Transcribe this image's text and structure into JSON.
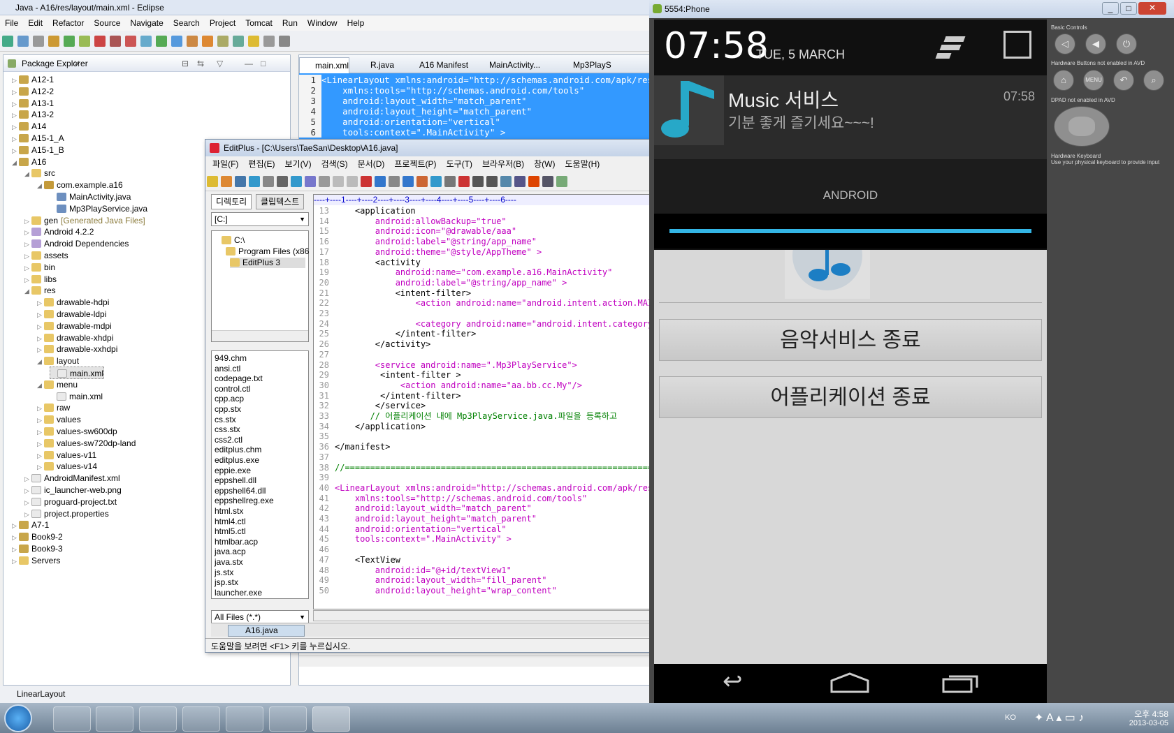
{
  "eclipse": {
    "title": "Java - A16/res/layout/main.xml - Eclipse",
    "menu": [
      "File",
      "Edit",
      "Refactor",
      "Source",
      "Navigate",
      "Search",
      "Project",
      "Tomcat",
      "Run",
      "Window",
      "Help"
    ],
    "package_explorer": {
      "title": "Package Explorer",
      "tree": [
        {
          "label": "A12-1",
          "kind": "project"
        },
        {
          "label": "A12-2",
          "kind": "project"
        },
        {
          "label": "A13-1",
          "kind": "project"
        },
        {
          "label": "A13-2",
          "kind": "project"
        },
        {
          "label": "A14",
          "kind": "project"
        },
        {
          "label": "A15-1_A",
          "kind": "project"
        },
        {
          "label": "A15-1_B",
          "kind": "project"
        },
        {
          "label": "A16",
          "kind": "project"
        },
        {
          "label": "src",
          "kind": "folder"
        },
        {
          "label": "com.example.a16",
          "kind": "package"
        },
        {
          "label": "MainActivity.java",
          "kind": "java"
        },
        {
          "label": "Mp3PlayService.java",
          "kind": "java"
        },
        {
          "label": "gen",
          "kind": "folder",
          "suffix": "[Generated Java Files]"
        },
        {
          "label": "Android 4.2.2",
          "kind": "lib"
        },
        {
          "label": "Android Dependencies",
          "kind": "lib"
        },
        {
          "label": "assets",
          "kind": "folder"
        },
        {
          "label": "bin",
          "kind": "folder"
        },
        {
          "label": "libs",
          "kind": "folder"
        },
        {
          "label": "res",
          "kind": "folder"
        },
        {
          "label": "drawable-hdpi",
          "kind": "folder"
        },
        {
          "label": "drawable-ldpi",
          "kind": "folder"
        },
        {
          "label": "drawable-mdpi",
          "kind": "folder"
        },
        {
          "label": "drawable-xhdpi",
          "kind": "folder"
        },
        {
          "label": "drawable-xxhdpi",
          "kind": "folder"
        },
        {
          "label": "layout",
          "kind": "folder"
        },
        {
          "label": "main.xml",
          "kind": "xml",
          "selected": true
        },
        {
          "label": "menu",
          "kind": "folder"
        },
        {
          "label": "main.xml",
          "kind": "xml"
        },
        {
          "label": "raw",
          "kind": "folder"
        },
        {
          "label": "values",
          "kind": "folder"
        },
        {
          "label": "values-sw600dp",
          "kind": "folder"
        },
        {
          "label": "values-sw720dp-land",
          "kind": "folder"
        },
        {
          "label": "values-v11",
          "kind": "folder"
        },
        {
          "label": "values-v14",
          "kind": "folder"
        },
        {
          "label": "AndroidManifest.xml",
          "kind": "xml"
        },
        {
          "label": "ic_launcher-web.png",
          "kind": "xml"
        },
        {
          "label": "proguard-project.txt",
          "kind": "xml"
        },
        {
          "label": "project.properties",
          "kind": "xml"
        },
        {
          "label": "A7-1",
          "kind": "project"
        },
        {
          "label": "Book9-2",
          "kind": "project"
        },
        {
          "label": "Book9-3",
          "kind": "project"
        },
        {
          "label": "Servers",
          "kind": "folder"
        }
      ]
    },
    "editor_tabs": [
      "main.xml",
      "R.java",
      "A16 Manifest",
      "MainActivity...",
      "Mp3PlayS"
    ],
    "editor_lines": [
      "<LinearLayout xmlns:android=\"http://schemas.android.com/apk/res/a",
      "    xmlns:tools=\"http://schemas.android.com/tools\"",
      "    android:layout_width=\"match_parent\"",
      "    android:layout_height=\"match_parent\"",
      "    android:orientation=\"vertical\"",
      "    tools:context=\".MainActivity\" >"
    ],
    "status": "LinearLayout"
  },
  "editplus": {
    "title": "EditPlus - [C:\\Users\\TaeSan\\Desktop\\A16.java]",
    "menu": [
      "파일(F)",
      "편집(E)",
      "보기(V)",
      "검색(S)",
      "문서(D)",
      "프로젝트(P)",
      "도구(T)",
      "브라우저(B)",
      "창(W)",
      "도움말(H)"
    ],
    "side_tabs": [
      "디렉토리",
      "클립텍스트"
    ],
    "drive": "[C:]",
    "dirs": [
      "C:\\",
      "Program Files (x86",
      "EditPlus 3"
    ],
    "files": [
      "949.chm",
      "ansi.ctl",
      "codepage.txt",
      "control.ctl",
      "cpp.acp",
      "cpp.stx",
      "cs.stx",
      "css.stx",
      "css2.ctl",
      "editplus.chm",
      "editplus.exe",
      "eppie.exe",
      "eppshell.dll",
      "eppshell64.dll",
      "eppshellreg.exe",
      "html.stx",
      "html4.ctl",
      "html5.ctl",
      "htmlbar.acp",
      "java.acp",
      "java.stx",
      "js.stx",
      "jsp.stx",
      "launcher.exe"
    ],
    "filter": "All Files (*.*)",
    "open_tab": "A16.java",
    "ruler": "----+----1----+----2----+----3----+----4----+----5----+----6----",
    "code": [
      {
        "n": "13",
        "t": "    <application"
      },
      {
        "n": "14",
        "t": "        android:allowBackup=\"true\""
      },
      {
        "n": "15",
        "t": "        android:icon=\"@drawable/aaa\""
      },
      {
        "n": "16",
        "t": "        android:label=\"@string/app_name\""
      },
      {
        "n": "17",
        "t": "        android:theme=\"@style/AppTheme\" >"
      },
      {
        "n": "18",
        "t": "        <activity"
      },
      {
        "n": "19",
        "t": "            android:name=\"com.example.a16.MainActivity\""
      },
      {
        "n": "20",
        "t": "            android:label=\"@string/app_name\" >"
      },
      {
        "n": "21",
        "t": "            <intent-filter>"
      },
      {
        "n": "22",
        "t": "                <action android:name=\"android.intent.action.MAIN"
      },
      {
        "n": "23",
        "t": ""
      },
      {
        "n": "24",
        "t": "                <category android:name=\"android.intent.category"
      },
      {
        "n": "25",
        "t": "            </intent-filter>"
      },
      {
        "n": "26",
        "t": "        </activity>"
      },
      {
        "n": "27",
        "t": ""
      },
      {
        "n": "28",
        "t": "        <service android:name=\".Mp3PlayService\">"
      },
      {
        "n": "29",
        "t": "         <intent-filter >"
      },
      {
        "n": "30",
        "t": "             <action android:name=\"aa.bb.cc.My\"/>"
      },
      {
        "n": "31",
        "t": "         </intent-filter>"
      },
      {
        "n": "32",
        "t": "        </service>"
      },
      {
        "n": "33",
        "t": "       // 어플리케이션 내에 Mp3PlayService.java.파일을 등록하고"
      },
      {
        "n": "34",
        "t": "    </application>"
      },
      {
        "n": "35",
        "t": ""
      },
      {
        "n": "36",
        "t": "</manifest>"
      },
      {
        "n": "37",
        "t": ""
      },
      {
        "n": "38",
        "t": "//================================================================"
      },
      {
        "n": "39",
        "t": ""
      },
      {
        "n": "40",
        "t": "<LinearLayout xmlns:android=\"http://schemas.android.com/apk/res"
      },
      {
        "n": "41",
        "t": "    xmlns:tools=\"http://schemas.android.com/tools\""
      },
      {
        "n": "42",
        "t": "    android:layout_width=\"match_parent\""
      },
      {
        "n": "43",
        "t": "    android:layout_height=\"match_parent\""
      },
      {
        "n": "44",
        "t": "    android:orientation=\"vertical\""
      },
      {
        "n": "45",
        "t": "    tools:context=\".MainActivity\" >"
      },
      {
        "n": "46",
        "t": ""
      },
      {
        "n": "47",
        "t": "    <TextView"
      },
      {
        "n": "48",
        "t": "        android:id=\"@+id/textView1\""
      },
      {
        "n": "49",
        "t": "        android:layout_width=\"fill_parent\""
      },
      {
        "n": "50",
        "t": "        android:layout_height=\"wrap_content\""
      }
    ],
    "status": "도움말을 보려면 <F1> 키를 누르십시오."
  },
  "emulator": {
    "title": "5554:Phone",
    "time": "07:58",
    "date": "TUE, 5 MARCH",
    "notification_title": "Music 서비스",
    "notification_text": "기분 좋게 즐기세요~~~!",
    "notification_time": "07:58",
    "carrier": "ANDROID",
    "button_stop_service": "음악서비스 종료",
    "button_exit_app": "어플리케이션 종료",
    "controls": {
      "basic_label": "Basic Controls",
      "hw_buttons_label": "Hardware Buttons not enabled in AVD",
      "dpad_label": "DPAD not enabled in AVD",
      "keyboard_label": "Hardware Keyboard",
      "keyboard_sub": "Use your physical keyboard to provide input",
      "menu_label": "MENU"
    }
  },
  "taskbar": {
    "lang": "KO",
    "clock_time": "오후 4:58",
    "clock_date": "2013-03-05"
  }
}
